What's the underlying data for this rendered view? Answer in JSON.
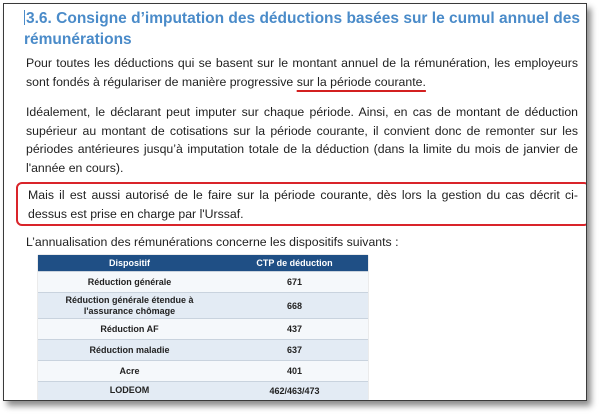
{
  "heading": "3.6. Consigne d’imputation des déductions basées sur le cumul annuel des rémunérations",
  "paragraph1": {
    "text": "Pour toutes les déductions qui se basent sur le montant annuel de la rémunération, les employeurs sont fondés à régulariser de manière progressive ",
    "underlined": "sur la période courante."
  },
  "paragraph2": "Idéalement, le déclarant peut imputer sur chaque période. Ainsi, en cas de montant de déduction supérieur au montant de cotisations sur la période courante, il convient donc de remonter sur les périodes antérieures jusqu’à imputation totale de la déduction (dans la limite du mois de janvier de l'année en cours).",
  "highlighted_paragraph": "Mais il est aussi autorisé de le faire sur la période courante, dès lors la gestion du cas décrit ci-dessus est prise en charge par l'Urssaf.",
  "paragraph4": "L’annualisation des rémunérations concerne les dispositifs suivants :",
  "table": {
    "headers": [
      "Dispositif",
      "CTP de déduction"
    ],
    "rows": [
      [
        "Réduction générale",
        "671"
      ],
      [
        "Réduction générale étendue à l'assurance chômage",
        "668"
      ],
      [
        "Réduction AF",
        "437"
      ],
      [
        "Réduction maladie",
        "637"
      ],
      [
        "Acre",
        "401"
      ],
      [
        "LODEOM",
        "462/463/473"
      ]
    ]
  },
  "colors": {
    "heading": "#4a8bc9",
    "table_header": "#1f4f85",
    "callout_border": "#d9242a",
    "underline": "#d32020"
  }
}
